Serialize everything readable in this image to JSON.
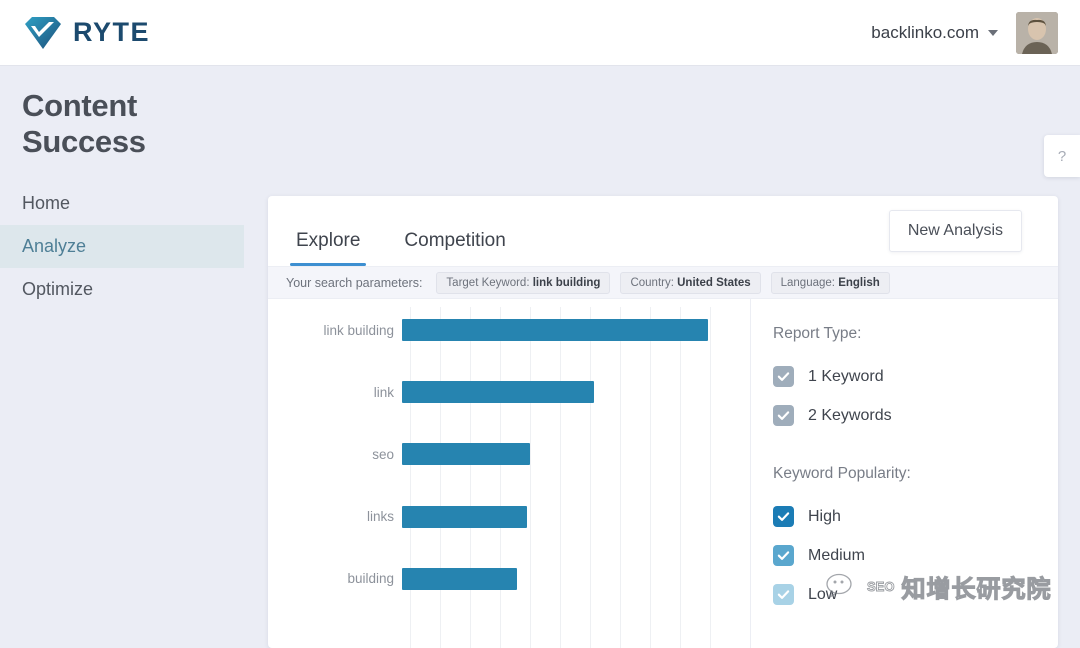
{
  "topbar": {
    "logo_text": "RYTE",
    "logo_icon": "ryte-diamond-check-logo",
    "domain": "backlinko.com",
    "caret_icon": "chevron-down-icon",
    "avatar_icon": "user-avatar"
  },
  "sidebar": {
    "title": "Content Success",
    "items": [
      {
        "label": "Home",
        "active": false
      },
      {
        "label": "Analyze",
        "active": true
      },
      {
        "label": "Optimize",
        "active": false
      }
    ]
  },
  "help": {
    "label": "?",
    "icon": "question-mark-icon"
  },
  "card": {
    "tabs": [
      {
        "label": "Explore",
        "active": true
      },
      {
        "label": "Competition",
        "active": false
      }
    ],
    "new_analysis_label": "New Analysis",
    "params_label": "Your search parameters:",
    "params": [
      {
        "key": "Target Keyword:",
        "value": "link building"
      },
      {
        "key": "Country:",
        "value": "United States"
      },
      {
        "key": "Language:",
        "value": "English"
      }
    ]
  },
  "filters": {
    "report_type_heading": "Report Type:",
    "report_type": [
      {
        "label": "1 Keyword",
        "checked": true,
        "color": "#9fadbb"
      },
      {
        "label": "2 Keywords",
        "checked": true,
        "color": "#9fadbb"
      }
    ],
    "popularity_heading": "Keyword Popularity:",
    "popularity": [
      {
        "label": "High",
        "checked": true,
        "color": "#1b7cb5"
      },
      {
        "label": "Medium",
        "checked": true,
        "color": "#5aa7ce"
      },
      {
        "label": "Low",
        "checked": true,
        "color": "#a8d2e6"
      }
    ]
  },
  "watermark": {
    "text": "知增长研究院",
    "prefix": "SEO",
    "icon": "wechat-icon"
  },
  "colors": {
    "page_bg": "#ebedf5",
    "bar": "#2684b0",
    "accent": "#3d8fd1",
    "nav_active_bg": "#dde7ec",
    "nav_active_text": "#4e7f96",
    "logo": "#1c4a6e"
  },
  "chart_data": {
    "type": "bar",
    "orientation": "horizontal",
    "title": "",
    "xlabel": "",
    "ylabel": "",
    "categories": [
      "link building",
      "link",
      "seo",
      "links",
      "building"
    ],
    "values": [
      100,
      62.8,
      41.8,
      40.9,
      37.6
    ],
    "xlim": [
      0,
      110
    ],
    "grid": true,
    "gridlines": [
      0,
      10,
      20,
      30,
      40,
      50,
      60,
      70,
      80,
      90,
      100
    ],
    "legend": "none",
    "series_color": "#2684b0"
  }
}
